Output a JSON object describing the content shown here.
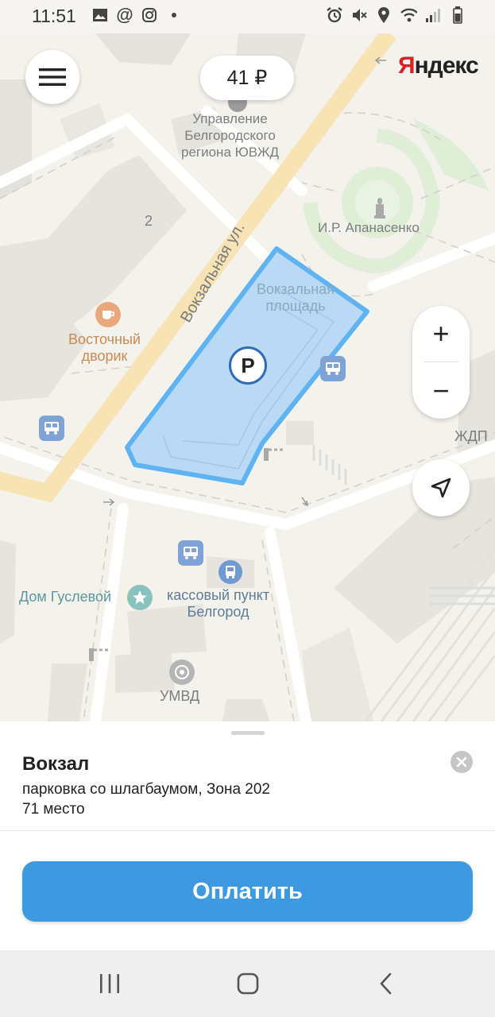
{
  "status_bar": {
    "time": "11:51",
    "left_icons": [
      "gallery-icon",
      "at-icon",
      "instagram-icon",
      "dot-icon"
    ],
    "right_icons": [
      "alarm-icon",
      "mute-icon",
      "location-icon",
      "wifi-icon",
      "signal-icon",
      "battery-icon"
    ]
  },
  "header": {
    "menu_icon": "menu-icon",
    "price": "41 ₽",
    "logo_first": "Я",
    "logo_rest": "ндекс"
  },
  "map": {
    "labels": {
      "poi_upravlenie": "Управление\nБелгородского\nрегиона ЮВЖД",
      "monument": "И.Р. Апанасенко",
      "street": "Вокзальная ул.",
      "square": "Вокзальная\nплощадь",
      "cafe": "Восточный\nдворик",
      "house_number": "2",
      "zhdp": "ЖДП",
      "dom_guslevoy": "Дом Гуслевой",
      "kassa": "кассовый пункт\nБелгород",
      "umvd": "УМВД"
    },
    "parking_symbol": "P",
    "zone_fill_color": "#b9d9f5",
    "zone_stroke_color": "#5fb3f2"
  },
  "controls": {
    "zoom_in": "+",
    "zoom_out": "−",
    "locate_icon": "navigation-arrow-icon"
  },
  "sheet": {
    "title": "Вокзал",
    "subtitle": "парковка со шлагбаумом, Зона 202",
    "capacity": "71 место",
    "pay_button": "Оплатить",
    "close_icon": "close-icon"
  },
  "navbar": {
    "icons": [
      "recent-apps-icon",
      "home-icon",
      "back-icon"
    ]
  }
}
